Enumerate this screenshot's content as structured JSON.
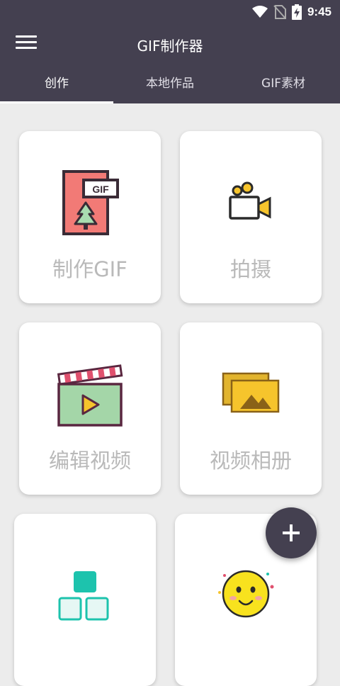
{
  "status_bar": {
    "time": "9:45",
    "icons": [
      "wifi-icon",
      "no-sim-icon",
      "battery-charging-icon"
    ]
  },
  "app_bar": {
    "title": "GIF制作器",
    "menu_icon": "menu-icon"
  },
  "tabs": [
    {
      "label": "创作",
      "active": true
    },
    {
      "label": "本地作品",
      "active": false
    },
    {
      "label": "GIF素材",
      "active": false
    }
  ],
  "cards": [
    {
      "label": "制作GIF",
      "icon": "gif-document-icon",
      "badge": "GIF"
    },
    {
      "label": "拍摄",
      "icon": "video-camera-icon"
    },
    {
      "label": "编辑视频",
      "icon": "clapperboard-icon"
    },
    {
      "label": "视频相册",
      "icon": "photo-album-icon"
    },
    {
      "label": "",
      "icon": "grid-blocks-icon"
    },
    {
      "label": "",
      "icon": "smiley-face-icon"
    }
  ],
  "fab": {
    "icon": "plus-icon"
  },
  "colors": {
    "primary": "#444050",
    "background": "#ececec",
    "label": "#b9b9b9"
  }
}
